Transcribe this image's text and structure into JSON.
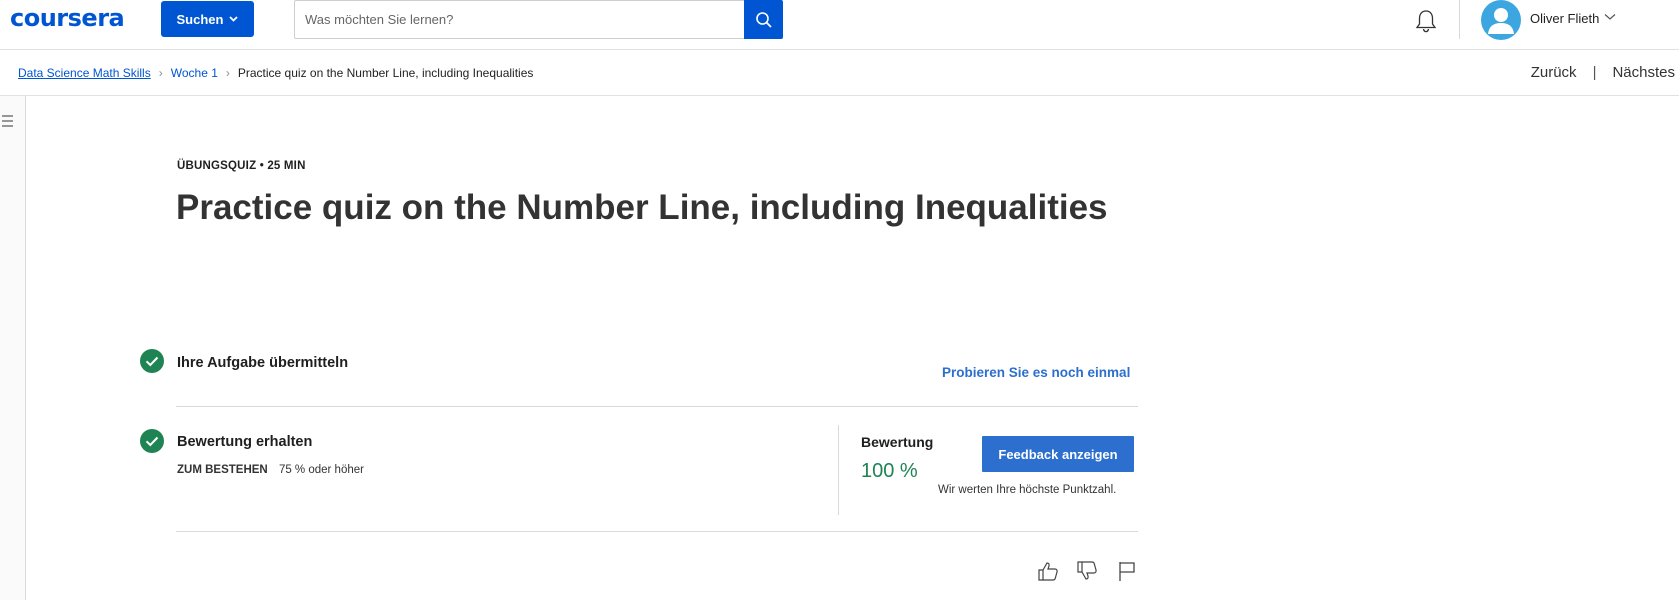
{
  "header": {
    "logo": "coursera",
    "explore_label": "Suchen",
    "search_placeholder": "Was möchten Sie lernen?",
    "user_name": "Oliver Flieth",
    "icons": [
      "search-icon",
      "bell-icon",
      "avatar",
      "chevron-down-icon"
    ]
  },
  "breadcrumb": {
    "items": [
      "Data Science Math Skills",
      "Woche 1"
    ],
    "current": "Practice quiz on the Number Line, including Inequalities"
  },
  "nav": {
    "previous": "Zurück",
    "divider": "|",
    "next": "Nächstes"
  },
  "quiz": {
    "eyebrow": "ÜBUNGSQUIZ • 25 MIN",
    "title": "Practice quiz on the Number Line, including Inequalities"
  },
  "steps": {
    "submit": {
      "title": "Ihre Aufgabe übermitteln",
      "retry_label": "Probieren Sie es noch einmal"
    },
    "grade": {
      "title": "Bewertung erhalten",
      "pass_label": "ZUM BESTEHEN",
      "pass_value": "75 % oder höher",
      "grade_label": "Bewertung",
      "grade_value": "100 %",
      "feedback_button": "Feedback anzeigen",
      "note": "Wir werten Ihre höchste Punktzahl."
    }
  },
  "colors": {
    "brand": "#0056d2",
    "link": "#2c6fce",
    "success": "#1f8354"
  },
  "footer_icons": [
    "thumbs-up-icon",
    "thumbs-down-icon",
    "flag-icon"
  ]
}
